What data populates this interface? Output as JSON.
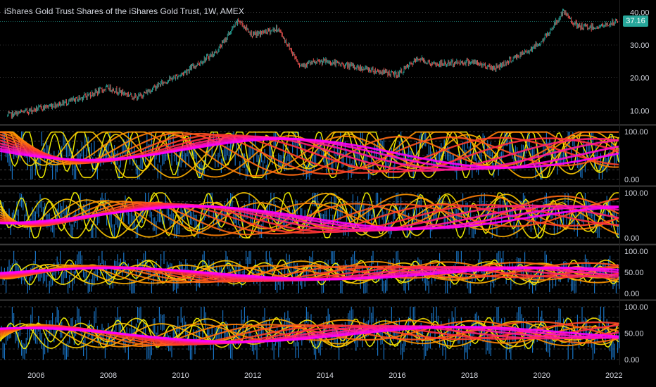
{
  "header": {
    "title": "iShares Gold Trust Shares of the iShares Gold Trust, 1W, AMEX",
    "last_price": "37.16"
  },
  "colors": {
    "background": "#000000",
    "up": "#26a69a",
    "down": "#ef5350",
    "osc_fast": "#1e88e5",
    "osc_ramp": [
      "#ffff00",
      "#ff8c00",
      "#ff3030",
      "#ff00ff"
    ],
    "grid": "#6b6b6b",
    "separator": "#3a3a3a",
    "axis_text": "#d1d4dc"
  },
  "chart_data": [
    {
      "type": "line",
      "subtype": "candlestick",
      "title": "iShares Gold Trust Shares of the iShares Gold Trust, 1W, AMEX",
      "x": [
        2005.2,
        2006,
        2007,
        2008,
        2008.8,
        2009.5,
        2010,
        2011,
        2011.6,
        2012,
        2012.7,
        2013.3,
        2014,
        2015,
        2016,
        2016.6,
        2017,
        2018,
        2018.7,
        2019.5,
        2020,
        2020.6,
        2021,
        2021.6,
        2022.1
      ],
      "values": [
        8.5,
        10.5,
        13,
        17,
        14,
        18.5,
        21,
        28,
        37.5,
        33,
        35,
        24,
        25,
        23,
        21,
        26,
        24,
        25,
        23,
        27.5,
        31,
        40,
        35.5,
        35.5,
        37.16
      ],
      "yticks": [
        "10.00",
        "20.00",
        "30.00",
        "40.00"
      ],
      "ylim": [
        6,
        42
      ],
      "last_value_label": "37.16"
    },
    {
      "type": "line",
      "subtype": "oscillator-ribbon",
      "yticks": [
        "0.00",
        "100.00"
      ],
      "ylim": [
        0,
        100
      ]
    },
    {
      "type": "line",
      "subtype": "oscillator-ribbon",
      "yticks": [
        "0.00",
        "100.00"
      ],
      "ylim": [
        0,
        100
      ]
    },
    {
      "type": "line",
      "subtype": "oscillator-ribbon",
      "yticks": [
        "0.00",
        "50.00",
        "100.00"
      ],
      "ylim": [
        0,
        100
      ]
    },
    {
      "type": "line",
      "subtype": "oscillator-ribbon",
      "yticks": [
        "0.00",
        "50.00",
        "100.00"
      ],
      "ylim": [
        0,
        100
      ]
    }
  ],
  "x_axis": {
    "ticks": [
      2006,
      2008,
      2010,
      2012,
      2014,
      2016,
      2018,
      2020,
      2022
    ],
    "range": [
      2005.0,
      2022.15
    ]
  }
}
